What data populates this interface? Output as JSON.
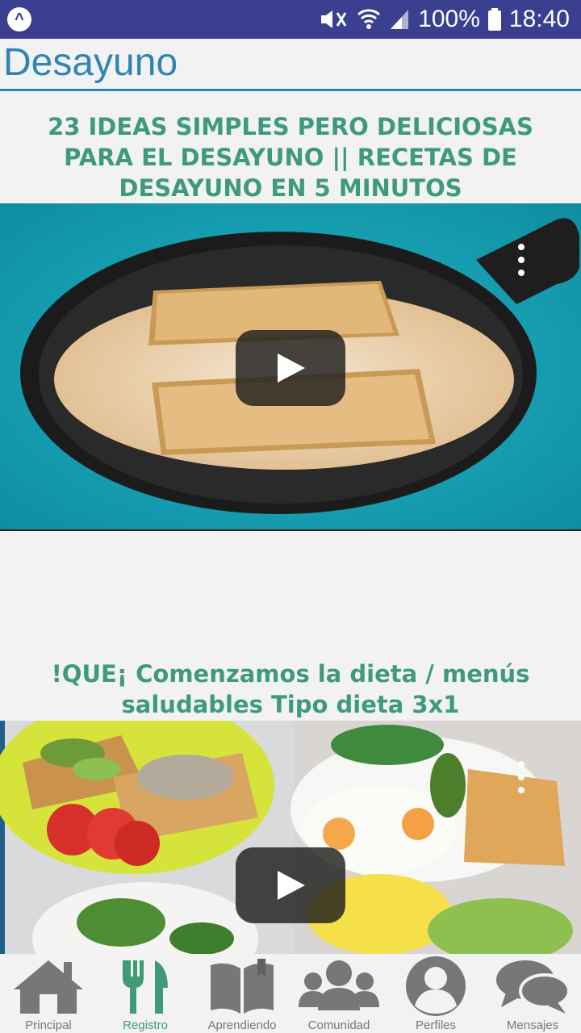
{
  "status_bar": {
    "battery": "100%",
    "time": "18:40",
    "app_icon": "app-logo-icon"
  },
  "header": {
    "title": "Desayuno"
  },
  "videos": [
    {
      "title": "23 IDEAS SIMPLES PERO DELICIOSAS PARA EL DESAYUNO || RECETAS DE DESAYUNO EN 5 MINUTOS"
    },
    {
      "title": "!QUE¡ Comenzamos la dieta / menús saludables Tipo dieta 3x1"
    }
  ],
  "bottom_nav": [
    {
      "label": "Principal",
      "icon": "home-icon"
    },
    {
      "label": "Registro",
      "icon": "fork-knife-icon",
      "active": true
    },
    {
      "label": "Aprendiendo",
      "icon": "book-icon"
    },
    {
      "label": "Comunidad",
      "icon": "group-icon"
    },
    {
      "label": "Perfiles",
      "icon": "profile-icon"
    },
    {
      "label": "Mensajes",
      "icon": "chat-icon"
    }
  ],
  "colors": {
    "status_bar": "#3a3f8f",
    "title_blue": "#2f86b3",
    "accent_green": "#3f9b77",
    "nav_gray": "#777777"
  }
}
